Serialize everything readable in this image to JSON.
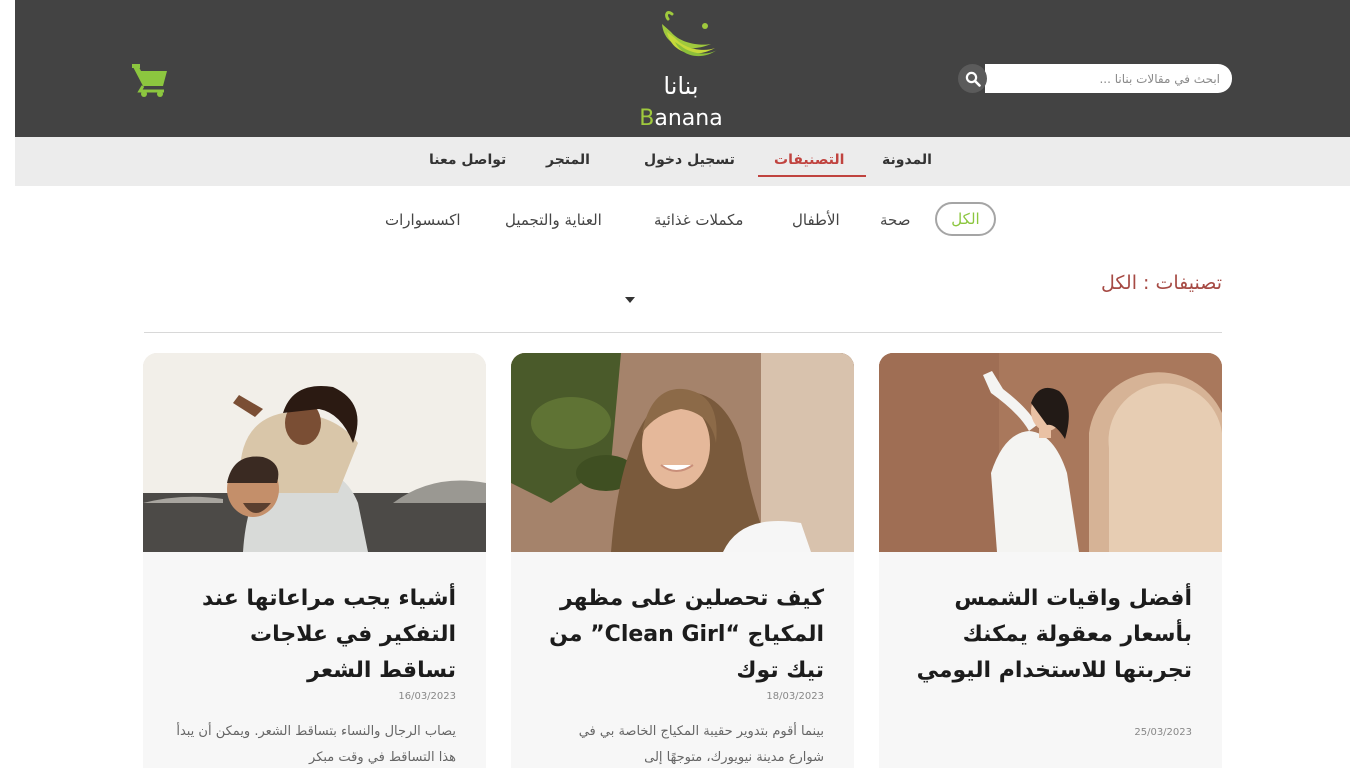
{
  "header": {
    "search_placeholder": "ابحث في مقالات بنانا ...",
    "logo_ar": "بنانا",
    "logo_en_first": "B",
    "logo_en_rest": "anana",
    "brand_green": "#8cc63f",
    "bar_color": "#434343"
  },
  "nav": {
    "items": [
      {
        "label": "المدونة"
      },
      {
        "label": "التصنيفات"
      },
      {
        "label": "تسجيل دخول"
      },
      {
        "label": "المتجر"
      },
      {
        "label": "تواصل معنا"
      }
    ],
    "active": "التصنيفات",
    "active_color": "#c0433f"
  },
  "categories": {
    "items": [
      {
        "label": "الكل"
      },
      {
        "label": "صحة"
      },
      {
        "label": "الأطفال"
      },
      {
        "label": "مكملات غذائية"
      },
      {
        "label": "العناية والتجميل"
      },
      {
        "label": "اكسسوارات"
      }
    ],
    "selected": "الكل"
  },
  "section_title": "تصنيفات : الكل",
  "cards": [
    {
      "title": "أفضل واقيات الشمس بأسعار معقولة يمكنك تجربتها للاستخدام اليومي",
      "date": "25/03/2023",
      "excerpt": ""
    },
    {
      "title": "كيف تحصلين على مظهر المكياج “Clean Girl” من تيك توك",
      "date": "18/03/2023",
      "excerpt": "بينما أقوم بتدوير حقيبة المكياج الخاصة بي في شوارع مدينة نيويورك، متوجهًا إلى"
    },
    {
      "title": "أشياء يجب مراعاتها عند التفكير في علاجات تساقط الشعر",
      "date": "16/03/2023",
      "excerpt": "يصاب الرجال والنساء بتساقط الشعر. ويمكن أن يبدأ هذا التساقط في وقت مبكر"
    }
  ]
}
